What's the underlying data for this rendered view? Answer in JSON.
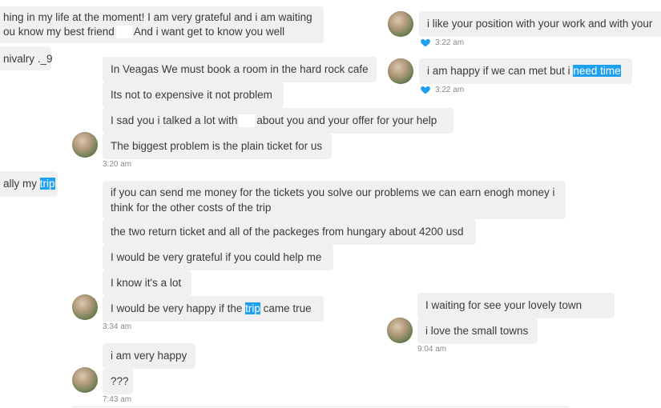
{
  "colors": {
    "bubble_bg": "#f0f0f0",
    "highlight": "#1ea0f0",
    "heart": "#1ea0f0",
    "timestamp": "#8a8a8a"
  },
  "left_column": {
    "m1_line1": "hing in my life at the moment! I am very grateful and i am waiting",
    "m1_line2_a": "ou know my best friend",
    "m1_line2_b": "And i want get to know you well",
    "m2": "nivalry ._9",
    "m3_prefix": "ally my ",
    "m3_highlight": "trip"
  },
  "center_column": {
    "g1": {
      "messages": [
        "In Veagas We must book a room in the hard rock cafe",
        "Its not to expensive it not problem"
      ],
      "m3_a": "I sad you i talked a lot with",
      "m3_b": "about you and your offer for your help",
      "m4": "The biggest problem is the plain ticket for us",
      "time": "3:20 am"
    },
    "g2": {
      "m1": "if you can send me money for the tickets you solve our problems we can earn enogh money i think for the other costs of the trip",
      "m2": "the two return ticket and all of the packeges from hungary about 4200 usd",
      "m3": "I would be very grateful if you could help me",
      "m4": "I know it's a lot",
      "m5_a": "I would be very happy if the ",
      "m5_highlight": "trip",
      "m5_b": " came true",
      "time": "3:34 am"
    },
    "g3": {
      "m1": "i am very happy",
      "m2": "???",
      "time": "7:43 am"
    }
  },
  "right_column": {
    "r1": {
      "message": "i like your position with your work and with your",
      "time": "3:22 am"
    },
    "r2": {
      "message_prefix": "i am happy if we can met but i ",
      "message_highlight": "need time",
      "time": "3:22 am"
    },
    "r3": {
      "m1": "I waiting for see your lovely town",
      "m2": "i love the small towns",
      "time": "9:04 am"
    }
  }
}
